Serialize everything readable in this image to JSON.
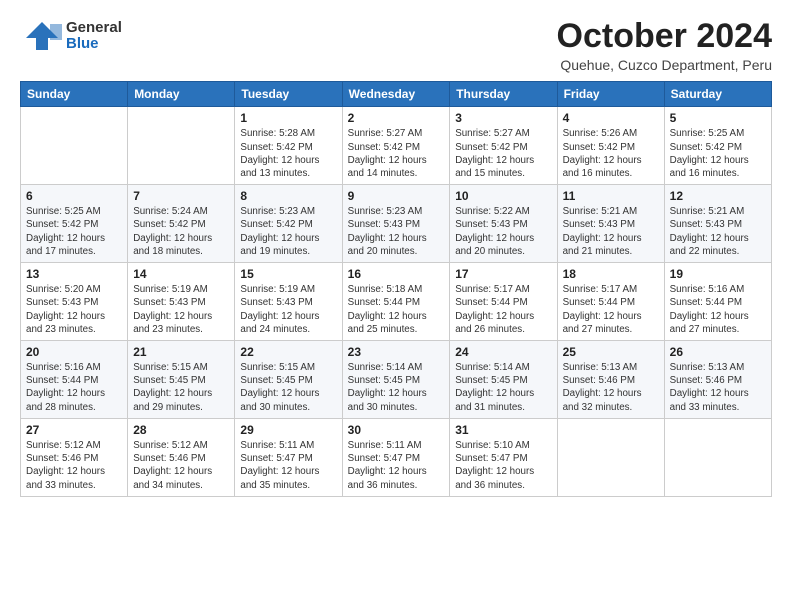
{
  "logo": {
    "line1": "General",
    "line2": "Blue"
  },
  "header": {
    "month": "October 2024",
    "location": "Quehue, Cuzco Department, Peru"
  },
  "weekdays": [
    "Sunday",
    "Monday",
    "Tuesday",
    "Wednesday",
    "Thursday",
    "Friday",
    "Saturday"
  ],
  "weeks": [
    [
      {
        "day": "",
        "info": ""
      },
      {
        "day": "",
        "info": ""
      },
      {
        "day": "1",
        "info": "Sunrise: 5:28 AM\nSunset: 5:42 PM\nDaylight: 12 hours\nand 13 minutes."
      },
      {
        "day": "2",
        "info": "Sunrise: 5:27 AM\nSunset: 5:42 PM\nDaylight: 12 hours\nand 14 minutes."
      },
      {
        "day": "3",
        "info": "Sunrise: 5:27 AM\nSunset: 5:42 PM\nDaylight: 12 hours\nand 15 minutes."
      },
      {
        "day": "4",
        "info": "Sunrise: 5:26 AM\nSunset: 5:42 PM\nDaylight: 12 hours\nand 16 minutes."
      },
      {
        "day": "5",
        "info": "Sunrise: 5:25 AM\nSunset: 5:42 PM\nDaylight: 12 hours\nand 16 minutes."
      }
    ],
    [
      {
        "day": "6",
        "info": "Sunrise: 5:25 AM\nSunset: 5:42 PM\nDaylight: 12 hours\nand 17 minutes."
      },
      {
        "day": "7",
        "info": "Sunrise: 5:24 AM\nSunset: 5:42 PM\nDaylight: 12 hours\nand 18 minutes."
      },
      {
        "day": "8",
        "info": "Sunrise: 5:23 AM\nSunset: 5:42 PM\nDaylight: 12 hours\nand 19 minutes."
      },
      {
        "day": "9",
        "info": "Sunrise: 5:23 AM\nSunset: 5:43 PM\nDaylight: 12 hours\nand 20 minutes."
      },
      {
        "day": "10",
        "info": "Sunrise: 5:22 AM\nSunset: 5:43 PM\nDaylight: 12 hours\nand 20 minutes."
      },
      {
        "day": "11",
        "info": "Sunrise: 5:21 AM\nSunset: 5:43 PM\nDaylight: 12 hours\nand 21 minutes."
      },
      {
        "day": "12",
        "info": "Sunrise: 5:21 AM\nSunset: 5:43 PM\nDaylight: 12 hours\nand 22 minutes."
      }
    ],
    [
      {
        "day": "13",
        "info": "Sunrise: 5:20 AM\nSunset: 5:43 PM\nDaylight: 12 hours\nand 23 minutes."
      },
      {
        "day": "14",
        "info": "Sunrise: 5:19 AM\nSunset: 5:43 PM\nDaylight: 12 hours\nand 23 minutes."
      },
      {
        "day": "15",
        "info": "Sunrise: 5:19 AM\nSunset: 5:43 PM\nDaylight: 12 hours\nand 24 minutes."
      },
      {
        "day": "16",
        "info": "Sunrise: 5:18 AM\nSunset: 5:44 PM\nDaylight: 12 hours\nand 25 minutes."
      },
      {
        "day": "17",
        "info": "Sunrise: 5:17 AM\nSunset: 5:44 PM\nDaylight: 12 hours\nand 26 minutes."
      },
      {
        "day": "18",
        "info": "Sunrise: 5:17 AM\nSunset: 5:44 PM\nDaylight: 12 hours\nand 27 minutes."
      },
      {
        "day": "19",
        "info": "Sunrise: 5:16 AM\nSunset: 5:44 PM\nDaylight: 12 hours\nand 27 minutes."
      }
    ],
    [
      {
        "day": "20",
        "info": "Sunrise: 5:16 AM\nSunset: 5:44 PM\nDaylight: 12 hours\nand 28 minutes."
      },
      {
        "day": "21",
        "info": "Sunrise: 5:15 AM\nSunset: 5:45 PM\nDaylight: 12 hours\nand 29 minutes."
      },
      {
        "day": "22",
        "info": "Sunrise: 5:15 AM\nSunset: 5:45 PM\nDaylight: 12 hours\nand 30 minutes."
      },
      {
        "day": "23",
        "info": "Sunrise: 5:14 AM\nSunset: 5:45 PM\nDaylight: 12 hours\nand 30 minutes."
      },
      {
        "day": "24",
        "info": "Sunrise: 5:14 AM\nSunset: 5:45 PM\nDaylight: 12 hours\nand 31 minutes."
      },
      {
        "day": "25",
        "info": "Sunrise: 5:13 AM\nSunset: 5:46 PM\nDaylight: 12 hours\nand 32 minutes."
      },
      {
        "day": "26",
        "info": "Sunrise: 5:13 AM\nSunset: 5:46 PM\nDaylight: 12 hours\nand 33 minutes."
      }
    ],
    [
      {
        "day": "27",
        "info": "Sunrise: 5:12 AM\nSunset: 5:46 PM\nDaylight: 12 hours\nand 33 minutes."
      },
      {
        "day": "28",
        "info": "Sunrise: 5:12 AM\nSunset: 5:46 PM\nDaylight: 12 hours\nand 34 minutes."
      },
      {
        "day": "29",
        "info": "Sunrise: 5:11 AM\nSunset: 5:47 PM\nDaylight: 12 hours\nand 35 minutes."
      },
      {
        "day": "30",
        "info": "Sunrise: 5:11 AM\nSunset: 5:47 PM\nDaylight: 12 hours\nand 36 minutes."
      },
      {
        "day": "31",
        "info": "Sunrise: 5:10 AM\nSunset: 5:47 PM\nDaylight: 12 hours\nand 36 minutes."
      },
      {
        "day": "",
        "info": ""
      },
      {
        "day": "",
        "info": ""
      }
    ]
  ]
}
